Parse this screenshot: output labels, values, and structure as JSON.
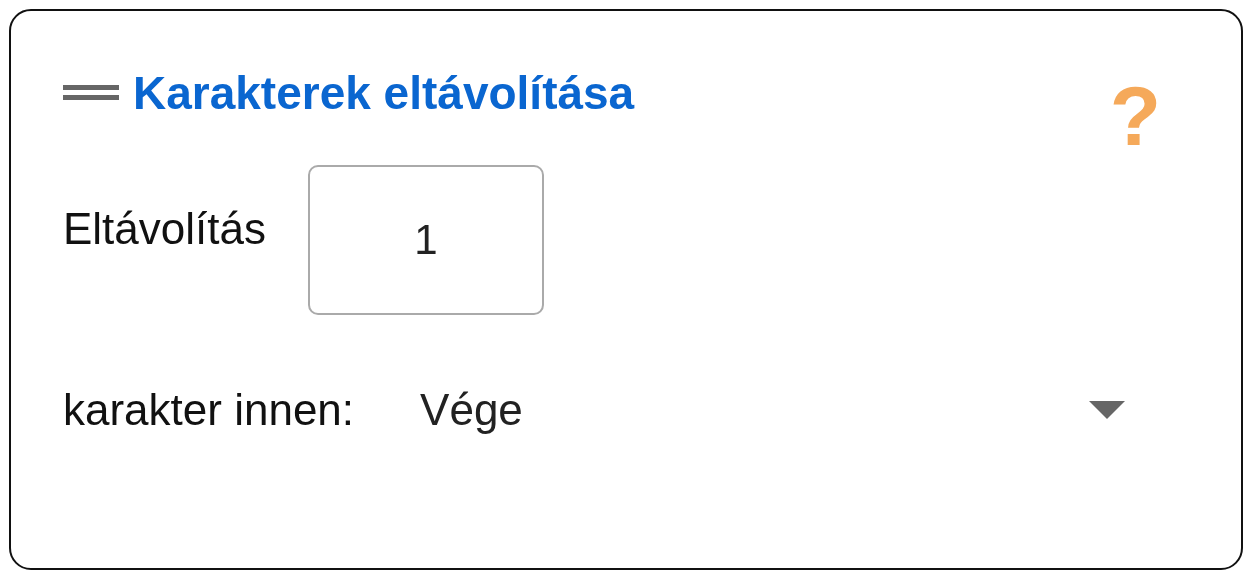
{
  "header": {
    "title": "Karakterek eltávolítása",
    "help": "?"
  },
  "remove": {
    "label": "Eltávolítás",
    "value": "1"
  },
  "source": {
    "label": "karakter innen:",
    "value": "Vége"
  }
}
